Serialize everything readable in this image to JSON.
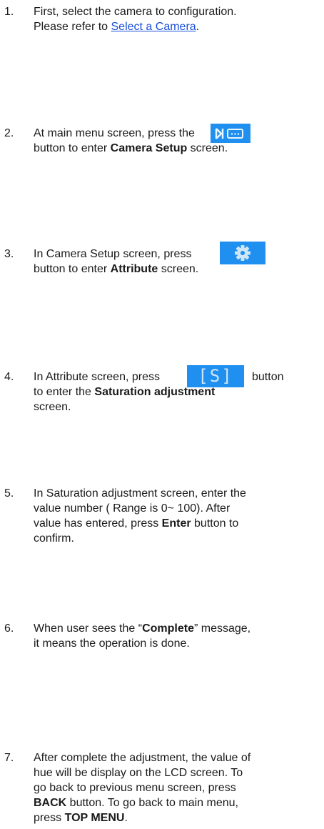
{
  "steps": [
    {
      "num": "1.",
      "line1": "First, select the camera to configuration.",
      "line2_pre": "Please refer to ",
      "link": "Select a Camera",
      "line2_post": "."
    },
    {
      "num": "2.",
      "line1": "At main menu screen, press the",
      "line2_pre": "button to enter ",
      "bold": "Camera Setup",
      "line2_post": " screen."
    },
    {
      "num": "3.",
      "line1": "In Camera Setup screen, press",
      "line2_pre": "button to enter ",
      "bold": "Attribute",
      "line2_post": " screen."
    },
    {
      "num": "4.",
      "line1_pre": "In Attribute screen, press",
      "line1_post": "button",
      "line2_pre": "to enter the ",
      "bold": "Saturation adjustment",
      "line3": "screen."
    },
    {
      "num": "5.",
      "line1": "In Saturation adjustment screen, enter the",
      "line2": "value number ( Range is 0~ 100). After",
      "line3_pre": "value has entered, press ",
      "bold": "Enter",
      "line3_post": " button to",
      "line4": "confirm."
    },
    {
      "num": "6.",
      "line1_pre": "When user sees the “",
      "bold": "Complete",
      "line1_post": "” message,",
      "line2": "it means the operation is done."
    },
    {
      "num": "7.",
      "line1": "After complete the adjustment, the value of",
      "line2": "hue will be display on the LCD screen. To",
      "line3": "go back to previous menu screen, press",
      "bold1": "BACK",
      "line4_post": " button. To go back to main menu,",
      "line5_pre": "press ",
      "bold2": "TOP MENU",
      "line5_post": "."
    }
  ],
  "buttons": {
    "camera_icon": "camera-setup-icon",
    "gear_icon": "gear-icon",
    "s_label": "[S]"
  },
  "colors": {
    "button_blue": "#1f8ff0",
    "link": "#1a4fd6"
  }
}
